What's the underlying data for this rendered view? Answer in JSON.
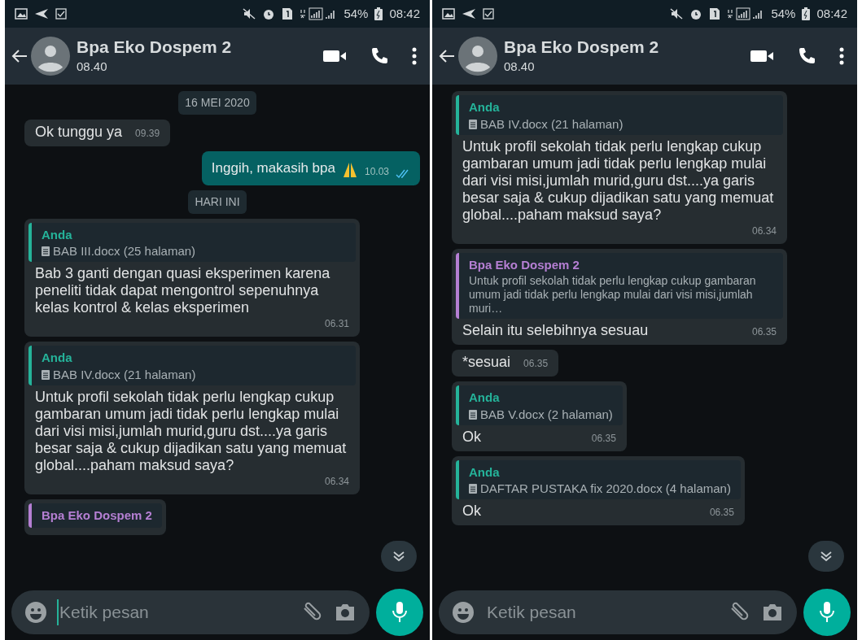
{
  "panes": [
    {
      "status": {
        "battery": "54%",
        "time": "08:42"
      },
      "header": {
        "name": "Bpa Eko Dospem 2",
        "last_seen": "08.40"
      },
      "messages": [
        {
          "kind": "date",
          "text": "16 MEI 2020"
        },
        {
          "kind": "in",
          "text": "Ok tunggu ya",
          "time": "09.39"
        },
        {
          "kind": "out",
          "text": "Inggih, makasih bpa",
          "time": "10.03",
          "read": true
        },
        {
          "kind": "date",
          "text": "HARI INI"
        },
        {
          "kind": "in",
          "quote": {
            "author": "Anda",
            "color": "#25b39a",
            "kind": "document",
            "text": "BAB III.docx (25 halaman)"
          },
          "text": "Bab 3 ganti dengan quasi eksperimen karena peneliti tidak dapat mengontrol sepenuhnya kelas kontrol & kelas eksperimen",
          "time": "06.31"
        },
        {
          "kind": "in",
          "quote": {
            "author": "Anda",
            "color": "#25b39a",
            "kind": "document",
            "text": "BAB IV.docx (21 halaman)"
          },
          "text": "Untuk profil sekolah tidak perlu lengkap cukup gambaran umum jadi tidak perlu lengkap mulai dari visi misi,jumlah murid,guru dst....ya garis besar saja & cukup dijadikan satu yang memuat global....paham maksud saya?",
          "time": "06.34"
        },
        {
          "kind": "in",
          "quote": {
            "author": "Bpa Eko Dospem 2",
            "color": "#b57fd3"
          }
        }
      ],
      "input": {
        "placeholder": "Ketik pesan",
        "focused": true
      }
    },
    {
      "status": {
        "battery": "54%",
        "time": "08:42"
      },
      "header": {
        "name": "Bpa Eko Dospem 2",
        "last_seen": "08.40"
      },
      "messages": [
        {
          "kind": "in",
          "quote": {
            "author": "Anda",
            "color": "#25b39a",
            "kind": "document",
            "text": "BAB IV.docx (21 halaman)"
          },
          "text": "Untuk profil sekolah tidak perlu lengkap cukup gambaran umum jadi tidak perlu lengkap mulai dari visi misi,jumlah murid,guru dst....ya garis besar saja & cukup dijadikan satu yang memuat global....paham maksud saya?",
          "time": "06.34"
        },
        {
          "kind": "in",
          "quote": {
            "author": "Bpa Eko Dospem 2",
            "color": "#b57fd3",
            "kind": "text",
            "text": "Untuk profil sekolah tidak perlu lengkap cukup gambaran umum jadi tidak perlu lengkap mulai dari visi misi,jumlah muri…"
          },
          "text": "Selain itu selebihnya sesuau",
          "time": "06.35"
        },
        {
          "kind": "in",
          "text": "*sesuai",
          "time": "06.35"
        },
        {
          "kind": "in",
          "quote": {
            "author": "Anda",
            "color": "#25b39a",
            "kind": "document",
            "text": "BAB V.docx (2 halaman)"
          },
          "text": "Ok",
          "time": "06.35"
        },
        {
          "kind": "in",
          "quote": {
            "author": "Anda",
            "color": "#25b39a",
            "kind": "document",
            "text": "DAFTAR PUSTAKA fix 2020.docx (4 halaman)"
          },
          "text": "Ok",
          "time": "06.35"
        }
      ],
      "input": {
        "placeholder": "Ketik pesan",
        "focused": false
      }
    }
  ]
}
